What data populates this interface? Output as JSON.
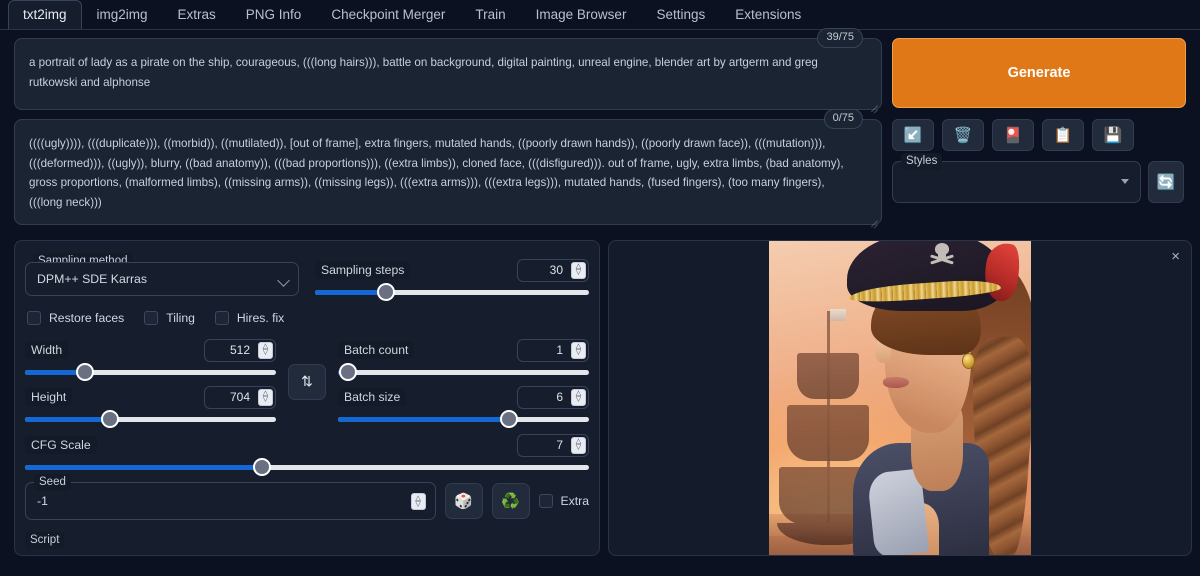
{
  "tabs": [
    {
      "label": "txt2img",
      "active": true
    },
    {
      "label": "img2img",
      "active": false
    },
    {
      "label": "Extras",
      "active": false
    },
    {
      "label": "PNG Info",
      "active": false
    },
    {
      "label": "Checkpoint Merger",
      "active": false
    },
    {
      "label": "Train",
      "active": false
    },
    {
      "label": "Image Browser",
      "active": false
    },
    {
      "label": "Settings",
      "active": false
    },
    {
      "label": "Extensions",
      "active": false
    }
  ],
  "prompt": {
    "positive": "a portrait of  lady as a pirate on the ship, courageous, (((long hairs))), battle on background, digital painting, unreal engine, blender art by artgerm and greg rutkowski and alphonse",
    "positive_counter": "39/75",
    "negative": "((((ugly)))), (((duplicate))), ((morbid)), ((mutilated)), [out of frame], extra fingers, mutated hands, ((poorly drawn hands)), ((poorly drawn face)), (((mutation))), (((deformed))), ((ugly)), blurry, ((bad anatomy)), (((bad proportions))), ((extra limbs)), cloned face, (((disfigured))). out of frame, ugly, extra limbs, (bad anatomy), gross proportions, (malformed limbs), ((missing arms)), ((missing legs)), (((extra arms))), (((extra legs))), mutated hands, (fused fingers), (too many fingers), (((long neck)))",
    "negative_counter": "0/75"
  },
  "generate": {
    "label": "Generate",
    "accent_color": "#e07818"
  },
  "icon_buttons": [
    {
      "name": "read-generation-parameters-button",
      "glyph": "↙️"
    },
    {
      "name": "clear-prompt-button",
      "glyph": "🗑️"
    },
    {
      "name": "show-extra-networks-button",
      "glyph": "🎴"
    },
    {
      "name": "apply-style-button",
      "glyph": "📋"
    },
    {
      "name": "save-style-button",
      "glyph": "💾"
    }
  ],
  "styles": {
    "label": "Styles",
    "value": "",
    "refresh_glyph": "🔄"
  },
  "sampling": {
    "method_label": "Sampling method",
    "method_value": "DPM++ SDE Karras",
    "steps_label": "Sampling steps",
    "steps_value": "30",
    "steps_percent": 26
  },
  "checkboxes": [
    {
      "label": "Restore faces",
      "checked": false
    },
    {
      "label": "Tiling",
      "checked": false
    },
    {
      "label": "Hires. fix",
      "checked": false
    }
  ],
  "dimensions": {
    "width_label": "Width",
    "width_value": "512",
    "width_percent": 24,
    "height_label": "Height",
    "height_value": "704",
    "height_percent": 34,
    "cfg_label": "CFG Scale",
    "cfg_value": "7",
    "cfg_percent": 42,
    "swap_glyph": "⇅"
  },
  "batch": {
    "count_label": "Batch count",
    "count_value": "1",
    "count_percent": 4,
    "size_label": "Batch size",
    "size_value": "6",
    "size_percent": 68
  },
  "seed": {
    "label": "Seed",
    "value": "-1",
    "random_glyph": "🎲",
    "recycle_glyph": "♻️",
    "extra_label": "Extra",
    "extra_checked": false
  },
  "script": {
    "label": "Script"
  },
  "output": {
    "close_glyph": "×",
    "image_alt": "portrait of a lady pirate with tricorn hat and tall ship at sunset"
  },
  "spinner_glyph": "⌃⌄"
}
